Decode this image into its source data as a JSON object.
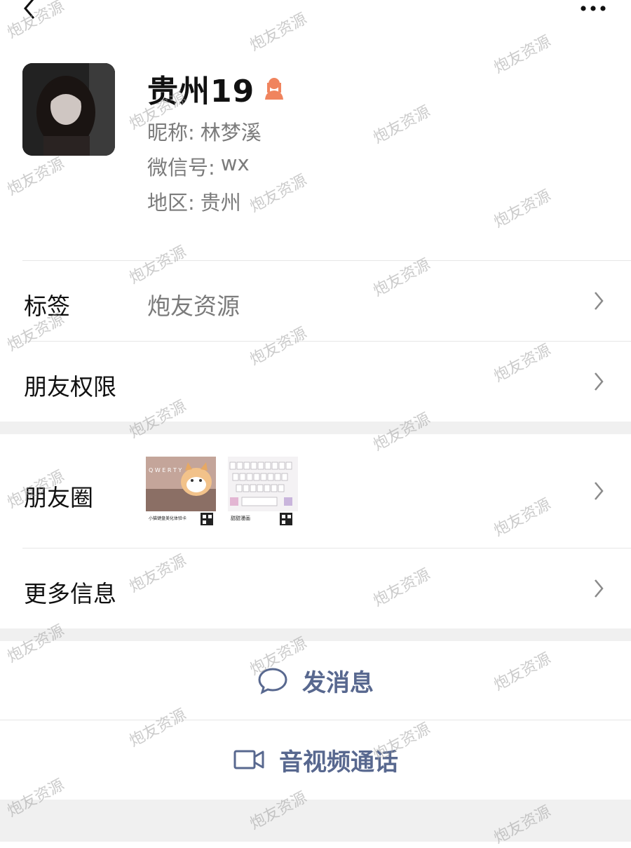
{
  "profile": {
    "name": "贵州19",
    "nickname_label": "昵称:",
    "nickname": "林梦溪",
    "wxid_label": "微信号:",
    "wxid": "wx",
    "region_label": "地区:",
    "region": "贵州"
  },
  "rows": {
    "tags": {
      "label": "标签",
      "value": "炮友资源"
    },
    "permissions": {
      "label": "朋友权限"
    },
    "moments": {
      "label": "朋友圈"
    },
    "more_info": {
      "label": "更多信息"
    }
  },
  "moments_thumbs": [
    {
      "keyboard_row": "Q W E R T Y",
      "caption": "小猫键盘美化体验卡"
    },
    {
      "caption": "甜甜漫画"
    }
  ],
  "actions": {
    "message": "发消息",
    "call": "音视频通话"
  },
  "watermark": "炮友资源",
  "colors": {
    "action_blue": "#58688f",
    "gender_icon": "#f0845e",
    "section_gap": "#f0f0f0"
  },
  "icons": {
    "back": "chevron-left-icon",
    "more": "more-dots-icon",
    "gender": "female-icon",
    "message": "chat-bubble-icon",
    "call": "video-camera-icon",
    "row_arrow": "chevron-right-icon"
  }
}
